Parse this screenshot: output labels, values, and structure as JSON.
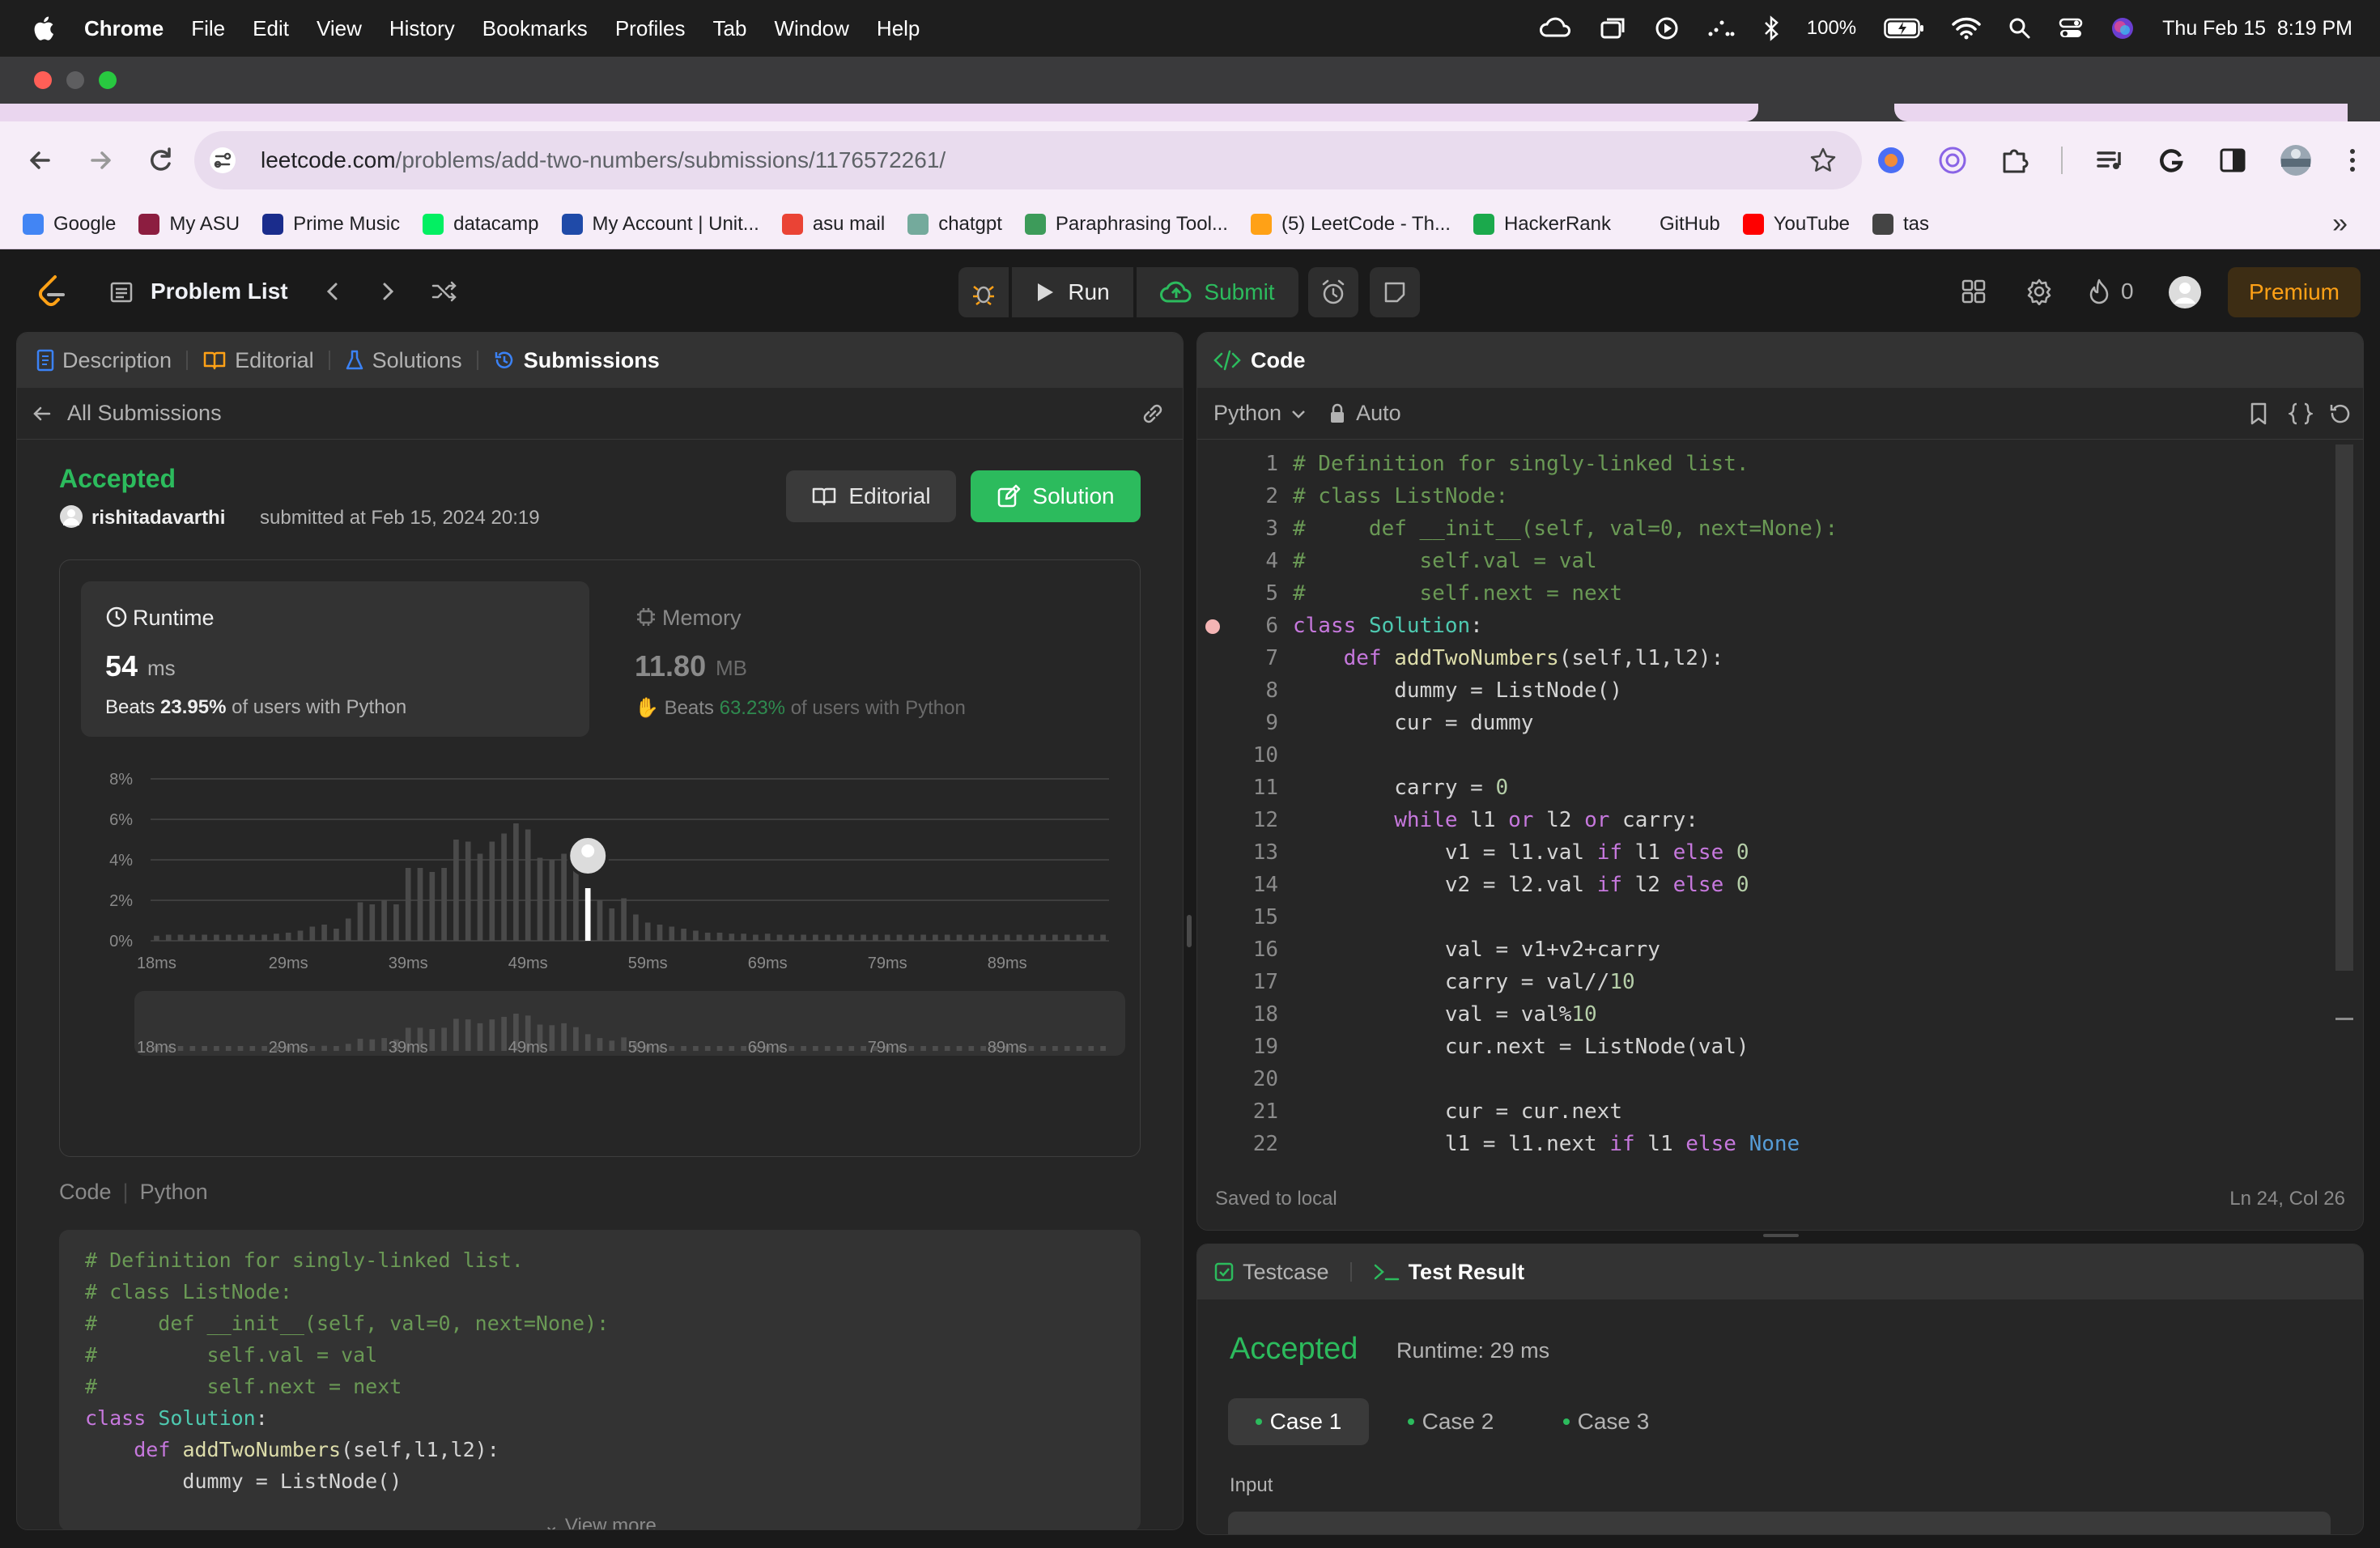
{
  "menubar": {
    "app": "Chrome",
    "items": [
      "File",
      "Edit",
      "View",
      "History",
      "Bookmarks",
      "Profiles",
      "Tab",
      "Window",
      "Help"
    ],
    "battery": "100%",
    "datetime": "Thu Feb 15  8:19 PM"
  },
  "browser": {
    "url_host": "leetcode.com",
    "url_path": "/problems/add-two-numbers/submissions/1176572261/",
    "bookmarks": [
      {
        "label": "Google",
        "color": "#4285f4"
      },
      {
        "label": "My ASU",
        "color": "#8c1d40"
      },
      {
        "label": "Prime Music",
        "color": "#1a2c8c"
      },
      {
        "label": "datacamp",
        "color": "#03ef62"
      },
      {
        "label": "My Account | Unit...",
        "color": "#1f4aa8"
      },
      {
        "label": "asu mail",
        "color": "#ea4335"
      },
      {
        "label": "chatgpt",
        "color": "#74aa9c"
      },
      {
        "label": "Paraphrasing Tool...",
        "color": "#3d9b5a"
      },
      {
        "label": "(5) LeetCode - Th...",
        "color": "#ffa116"
      },
      {
        "label": "HackerRank",
        "color": "#1ba94c"
      },
      {
        "label": "GitHub",
        "color": ""
      },
      {
        "label": "YouTube",
        "color": "#ff0000"
      },
      {
        "label": "tas",
        "color": "#444444"
      }
    ]
  },
  "leetcode": {
    "problem_list": "Problem List",
    "run": "Run",
    "submit": "Submit",
    "streak": "0",
    "premium": "Premium"
  },
  "left_panel": {
    "tabs": [
      "Description",
      "Editorial",
      "Solutions",
      "Submissions"
    ],
    "back": "All Submissions",
    "status": "Accepted",
    "user": "rishitadavarthi",
    "submitted": "submitted at Feb 15, 2024 20:19",
    "editorial_btn": "Editorial",
    "solution_btn": "Solution",
    "runtime_label": "Runtime",
    "runtime_value": "54",
    "runtime_unit": "ms",
    "runtime_beats_pre": "Beats",
    "runtime_beats": "23.95%",
    "runtime_beats_post": "of users with Python",
    "memory_label": "Memory",
    "memory_value": "11.80",
    "memory_unit": "MB",
    "memory_beats_pre": "Beats",
    "memory_beats": "63.23%",
    "memory_beats_post": "of users with Python",
    "code_label": "Code",
    "code_lang": "Python",
    "view_more": "View more",
    "code_lines": [
      "# Definition for singly-linked list.",
      "# class ListNode:",
      "#     def __init__(self, val=0, next=None):",
      "#         self.val = val",
      "#         self.next = next",
      "class Solution:",
      "    def addTwoNumbers(self,l1,l2):",
      "        dummy = ListNode()"
    ]
  },
  "chart_data": {
    "type": "bar",
    "title": "",
    "xlabel": "",
    "ylabel": "",
    "ylim": [
      0,
      8
    ],
    "y_ticks": [
      "8%",
      "6%",
      "4%",
      "2%",
      "0%"
    ],
    "x_tick_labels": [
      "18ms",
      "29ms",
      "39ms",
      "49ms",
      "59ms",
      "69ms",
      "79ms",
      "89ms"
    ],
    "x_tick_values": [
      18,
      29,
      39,
      49,
      59,
      69,
      79,
      89
    ],
    "x": [
      18,
      19,
      20,
      21,
      22,
      23,
      24,
      25,
      26,
      27,
      28,
      29,
      30,
      31,
      32,
      33,
      34,
      35,
      36,
      37,
      38,
      39,
      40,
      41,
      42,
      43,
      44,
      45,
      46,
      47,
      48,
      49,
      50,
      51,
      52,
      53,
      54,
      55,
      56,
      57,
      58,
      59,
      60,
      61,
      62,
      63,
      64,
      65,
      66,
      67,
      68,
      69,
      70,
      71,
      72,
      73,
      74,
      75,
      76,
      77,
      78,
      79,
      80,
      81,
      82,
      83,
      84,
      85,
      86,
      87,
      88,
      89,
      90,
      91,
      92,
      93,
      94,
      95,
      96,
      97
    ],
    "values": [
      0.25,
      0.3,
      0.3,
      0.3,
      0.3,
      0.3,
      0.3,
      0.3,
      0.3,
      0.3,
      0.35,
      0.4,
      0.5,
      0.7,
      0.8,
      0.6,
      1.1,
      1.9,
      1.8,
      2.0,
      1.8,
      3.6,
      3.6,
      3.4,
      3.6,
      5.0,
      4.9,
      4.3,
      4.9,
      5.3,
      5.8,
      5.5,
      4.1,
      4.0,
      4.3,
      3.7,
      2.6,
      2.0,
      1.6,
      2.1,
      1.3,
      0.9,
      0.8,
      0.7,
      0.6,
      0.5,
      0.4,
      0.4,
      0.35,
      0.35,
      0.3,
      0.35,
      0.3,
      0.3,
      0.3,
      0.3,
      0.3,
      0.3,
      0.3,
      0.3,
      0.3,
      0.3,
      0.3,
      0.3,
      0.3,
      0.3,
      0.3,
      0.3,
      0.3,
      0.3,
      0.3,
      0.3,
      0.3,
      0.3,
      0.3,
      0.3,
      0.3,
      0.3,
      0.3,
      0.3
    ],
    "highlight_x": 54,
    "grid": true
  },
  "editor": {
    "title": "Code",
    "language": "Python",
    "mode": "Auto",
    "status": "Saved to local",
    "cursor": "Ln 24, Col 26",
    "breakpoint_line": 6,
    "lines": [
      "# Definition for singly-linked list.",
      "# class ListNode:",
      "#     def __init__(self, val=0, next=None):",
      "#         self.val = val",
      "#         self.next = next",
      "class Solution:",
      "    def addTwoNumbers(self,l1,l2):",
      "        dummy = ListNode()",
      "        cur = dummy",
      "",
      "        carry = 0",
      "        while l1 or l2 or carry:",
      "            v1 = l1.val if l1 else 0",
      "            v2 = l2.val if l2 else 0",
      "",
      "            val = v1+v2+carry",
      "            carry = val//10",
      "            val = val%10",
      "            cur.next = ListNode(val)",
      "",
      "            cur = cur.next",
      "            l1 = l1.next if l1 else None"
    ]
  },
  "result": {
    "tab_testcase": "Testcase",
    "tab_result": "Test Result",
    "status": "Accepted",
    "runtime": "Runtime: 29 ms",
    "cases": [
      "Case 1",
      "Case 2",
      "Case 3"
    ],
    "input_label": "Input"
  }
}
